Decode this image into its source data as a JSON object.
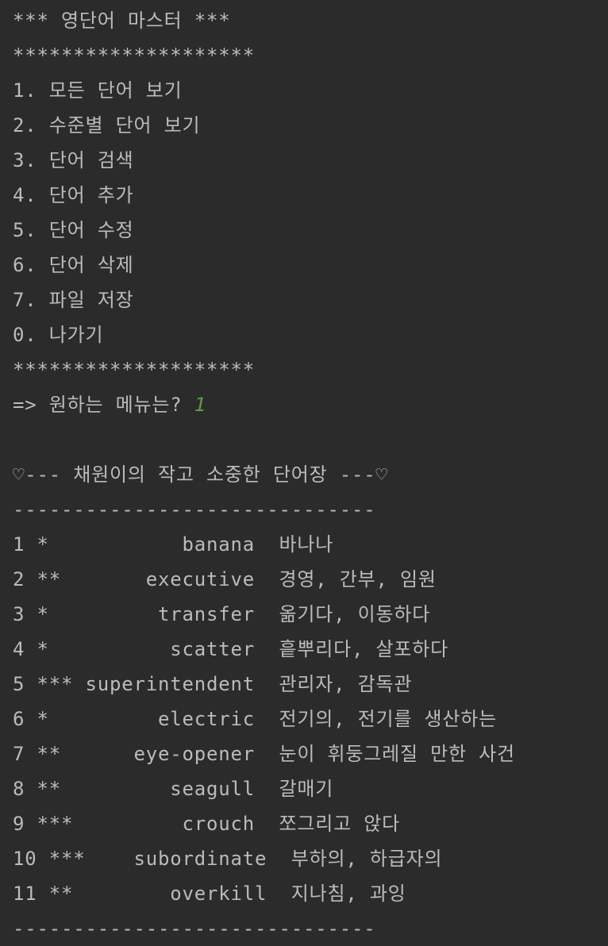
{
  "console": {
    "title": "*** 영단어 마스터 ***",
    "separator_stars": "********************",
    "menu_items": [
      "1. 모든 단어 보기",
      "2. 수준별 단어 보기",
      "3. 단어 검색",
      "4. 단어 추가",
      "5. 단어 수정",
      "6. 단어 삭제",
      "7. 파일 저장",
      "0. 나가기"
    ],
    "prompt": "=> 원하는 메뉴는? ",
    "input_value": "1",
    "list_title": "♡--- 채원이의 작고 소중한 단어장 ---♡",
    "separator_dashes": "------------------------------",
    "words": [
      {
        "no": "1",
        "level": "*",
        "word": "banana",
        "meaning": "바나나"
      },
      {
        "no": "2",
        "level": "**",
        "word": "executive",
        "meaning": "경영, 간부, 임원"
      },
      {
        "no": "3",
        "level": "*",
        "word": "transfer",
        "meaning": "옮기다, 이동하다"
      },
      {
        "no": "4",
        "level": "*",
        "word": "scatter",
        "meaning": "흩뿌리다, 살포하다"
      },
      {
        "no": "5",
        "level": "***",
        "word": "superintendent",
        "meaning": "관리자, 감독관"
      },
      {
        "no": "6",
        "level": "*",
        "word": "electric",
        "meaning": "전기의, 전기를 생산하는"
      },
      {
        "no": "7",
        "level": "**",
        "word": "eye-opener",
        "meaning": "눈이 휘둥그레질 만한 사건"
      },
      {
        "no": "8",
        "level": "**",
        "word": "seagull",
        "meaning": "갈매기"
      },
      {
        "no": "9",
        "level": "***",
        "word": "crouch",
        "meaning": "쪼그리고 앉다"
      },
      {
        "no": "10",
        "level": "***",
        "word": "subordinate",
        "meaning": "부하의, 하급자의"
      },
      {
        "no": "11",
        "level": "**",
        "word": "overkill",
        "meaning": "지나침, 과잉"
      }
    ]
  }
}
